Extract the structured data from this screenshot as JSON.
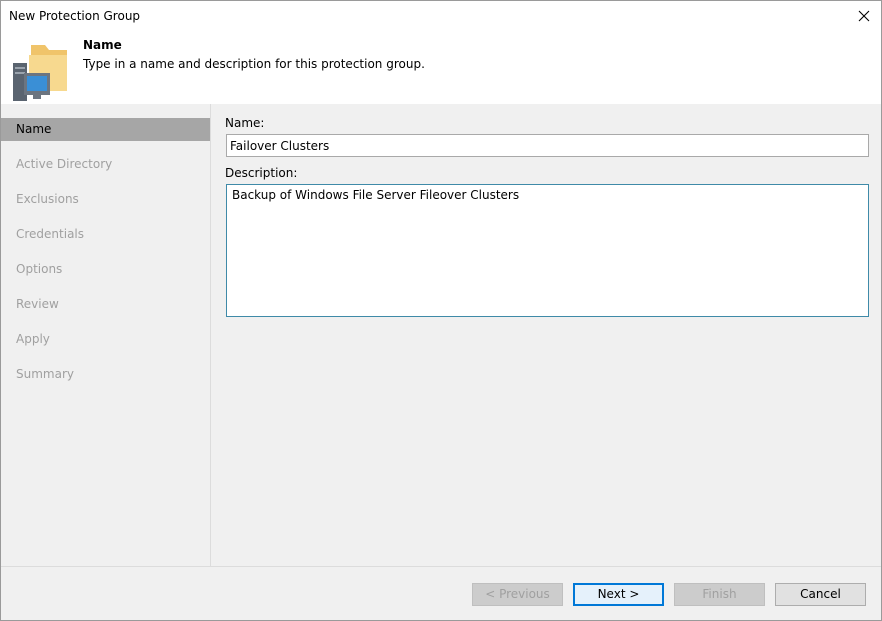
{
  "window": {
    "title": "New Protection Group"
  },
  "header": {
    "title": "Name",
    "subtitle": "Type in a name and description for this protection group."
  },
  "sidebar": {
    "items": [
      {
        "label": "Name",
        "active": true
      },
      {
        "label": "Active Directory",
        "active": false
      },
      {
        "label": "Exclusions",
        "active": false
      },
      {
        "label": "Credentials",
        "active": false
      },
      {
        "label": "Options",
        "active": false
      },
      {
        "label": "Review",
        "active": false
      },
      {
        "label": "Apply",
        "active": false
      },
      {
        "label": "Summary",
        "active": false
      }
    ]
  },
  "form": {
    "name_label": "Name:",
    "name_value": "Failover Clusters",
    "description_label": "Description:",
    "description_value": "Backup of Windows File Server Fileover Clusters"
  },
  "footer": {
    "previous_label": "< Previous",
    "next_label": "Next >",
    "finish_label": "Finish",
    "cancel_label": "Cancel"
  },
  "colors": {
    "active_step_bg": "#a6a6a6",
    "focus_border": "#3f8aa8",
    "primary_button_border": "#0078d7"
  },
  "icons": {
    "header": "protection-group-folder-computer-icon",
    "close": "close-icon"
  }
}
